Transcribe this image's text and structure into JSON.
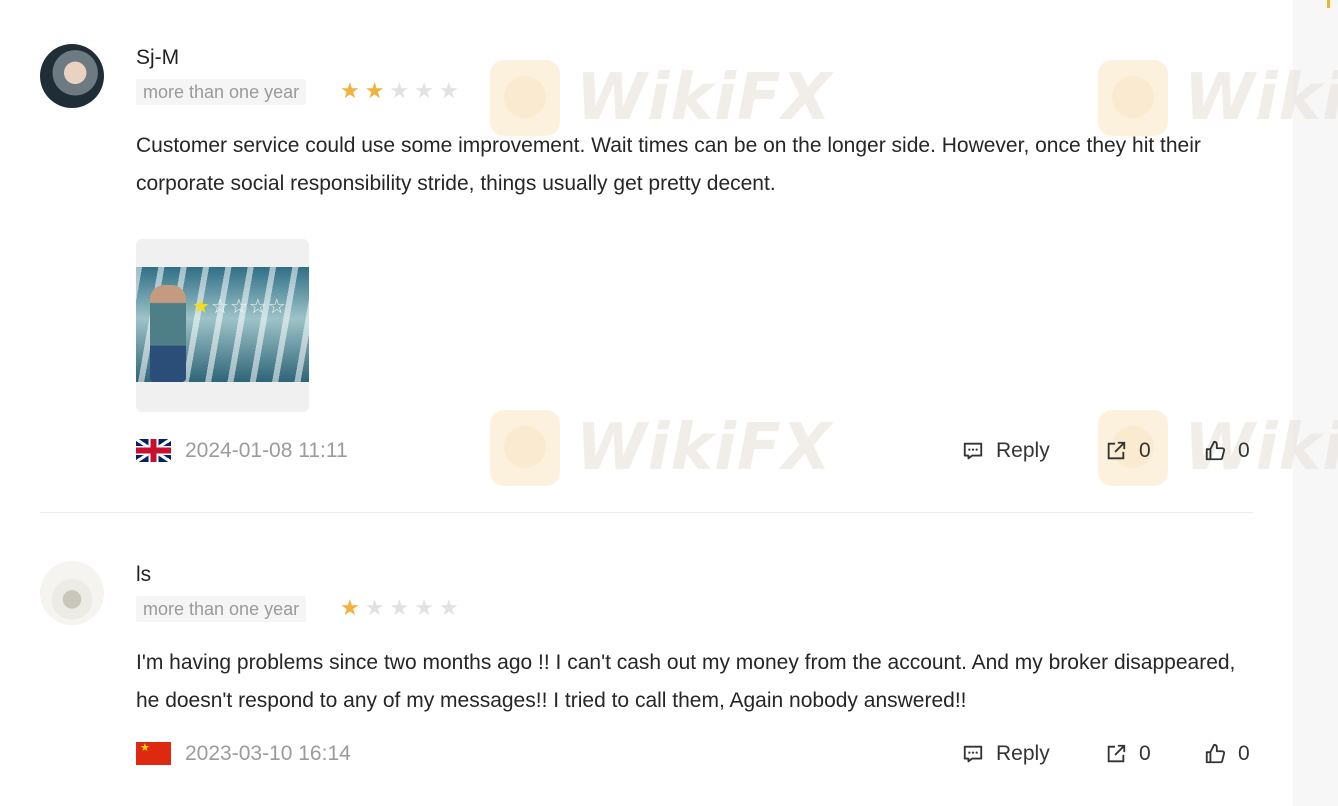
{
  "watermark": {
    "brand": "WikiFX"
  },
  "reviews": [
    {
      "username": "Sj-M",
      "time_badge": "more than one year",
      "rating": 2,
      "rating_max": 5,
      "text": "Customer service could use some improvement. Wait times can be on the longer side. However, once they hit their corporate social responsibility stride, things usually get pretty decent.",
      "has_image": true,
      "flag": "uk-flag",
      "date": "2024-01-08 11:11",
      "reply_label": "Reply",
      "share_count": "0",
      "like_count": "0"
    },
    {
      "username": "ls",
      "time_badge": "more than one year",
      "rating": 1,
      "rating_max": 5,
      "text": "I'm having problems since two months ago !! I can't cash out my money from the account. And my broker disappeared, he doesn't respond to any of my messages!! I tried to call them, Again nobody answered!!",
      "has_image": false,
      "flag": "china-flag",
      "date": "2023-03-10 16:14",
      "reply_label": "Reply",
      "share_count": "0",
      "like_count": "0"
    }
  ],
  "colors": {
    "star_on": "#f2b23c",
    "star_off": "#e2e2e2",
    "muted_text": "#9b9b9b"
  },
  "icons": {
    "reply": "comment-icon",
    "share": "share-icon",
    "like": "thumbs-up-icon",
    "star": "star-icon"
  }
}
